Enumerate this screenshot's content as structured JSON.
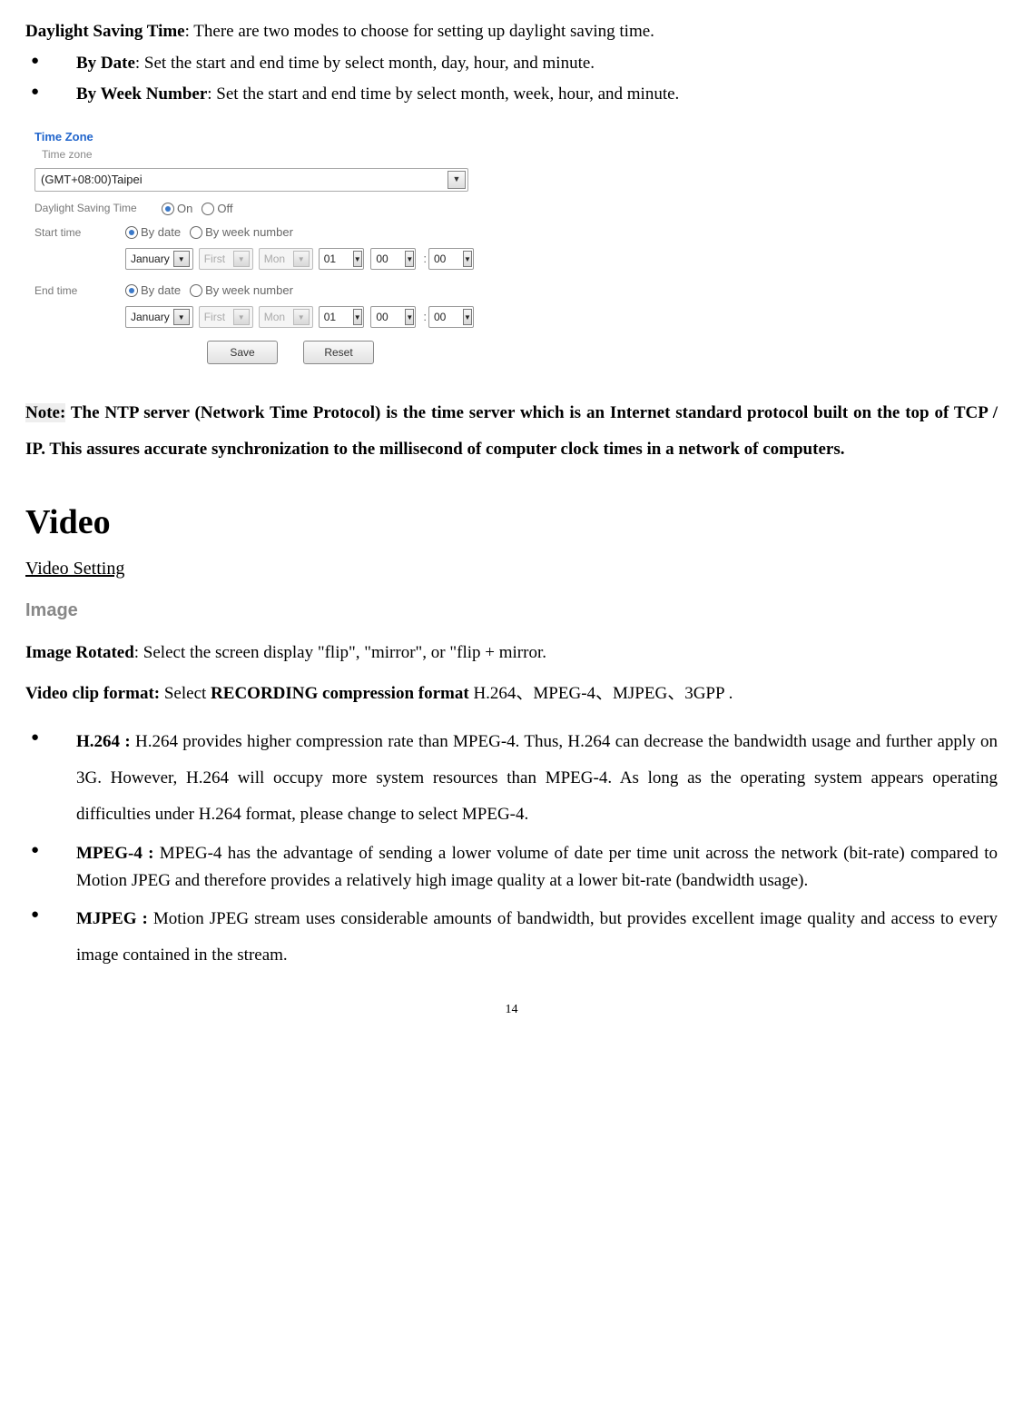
{
  "intro": {
    "dst_label": "Daylight Saving Time",
    "dst_text": ": There are two modes to choose for setting up daylight saving time.",
    "by_date_label": "By Date",
    "by_date_text": ": Set the start and end time by select month, day, hour, and minute.",
    "by_week_label": "By Week Number",
    "by_week_text": ": Set the start and end time by select month, week, hour, and minute."
  },
  "figure": {
    "section": "Time Zone",
    "subtitle": "Time zone",
    "tz_value": "(GMT+08:00)Taipei",
    "dst_label": "Daylight Saving Time",
    "on": "On",
    "off": "Off",
    "start_label": "Start time",
    "end_label": "End time",
    "by_date": "By date",
    "by_week": "By week number",
    "month": "January",
    "first": "First",
    "weekday": "Mon",
    "day": "01",
    "hour": "00",
    "minute": "00",
    "colon": ":",
    "save": "Save",
    "reset": "Reset"
  },
  "note": {
    "label": "Note:",
    "text": " The NTP server (Network Time Protocol) is the time server which is an Internet standard protocol built on the top of TCP / IP. This assures accurate synchronization to the millisecond of computer clock times in a network of computers."
  },
  "video": {
    "heading": "Video",
    "link": "Video Setting",
    "image_heading": "Image",
    "image_rotated_label": "Image Rotated",
    "image_rotated_text": ": Select the screen display \"flip\", \"mirror\", or \"flip + mirror.",
    "clip_label": "Video clip format: ",
    "clip_mid": "Select ",
    "clip_bold": "RECORDING compression format",
    "clip_tail": " H.264、MPEG-4、MJPEG、3GPP .",
    "h264_label": "H.264 :",
    "h264_text": " H.264 provides higher compression rate than MPEG-4. Thus, H.264 can decrease the bandwidth usage and further apply on 3G. However, H.264 will occupy more system resources than MPEG-4. As long as the operating system appears operating difficulties under H.264 format, please change to select MPEG-4.",
    "mpeg4_label": "MPEG-4 :",
    "mpeg4_text": " MPEG-4 has the advantage of sending a lower volume of date per time unit across the network (bit-rate) compared to Motion JPEG and therefore provides a relatively high image quality at a lower bit-rate (bandwidth usage).",
    "mjpeg_label": "MJPEG :",
    "mjpeg_text": " Motion JPEG stream uses considerable amounts of bandwidth, but provides excellent image quality and access to every image contained in the stream."
  },
  "page_number": "14"
}
